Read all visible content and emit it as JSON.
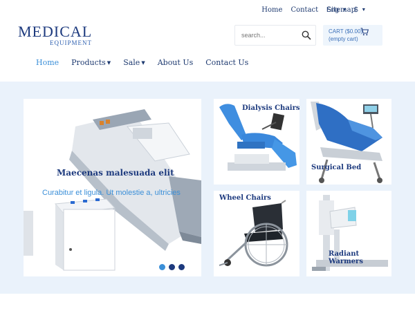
{
  "top_links": [
    "Home",
    "Contact",
    "Sitemap"
  ],
  "language": "Eng",
  "currency": "$",
  "logo": {
    "main": "MEDICAL",
    "sub": "EQUIPMENT"
  },
  "search": {
    "placeholder": "search..."
  },
  "cart": {
    "line1": "CART ($0.00)",
    "line2": "(empty cart)"
  },
  "main_nav": {
    "home": "Home",
    "products": "Products",
    "sale": "Sale",
    "about": "About Us",
    "contact": "Contact Us"
  },
  "hero": {
    "title": "Maecenas malesuada elit",
    "subtitle": "Curabitur et ligula. Ut molestie a, ultricies"
  },
  "tiles": {
    "dialysis": "Dialysis Chairs",
    "surgical": "Surgical Bed",
    "wheel": "Wheel Chairs",
    "radiant_line1": "Radiant",
    "radiant_line2": "Warmers"
  },
  "colors": {
    "brand": "#1d3a7e",
    "accent": "#3b8fd8",
    "band": "#eaf2fb"
  }
}
